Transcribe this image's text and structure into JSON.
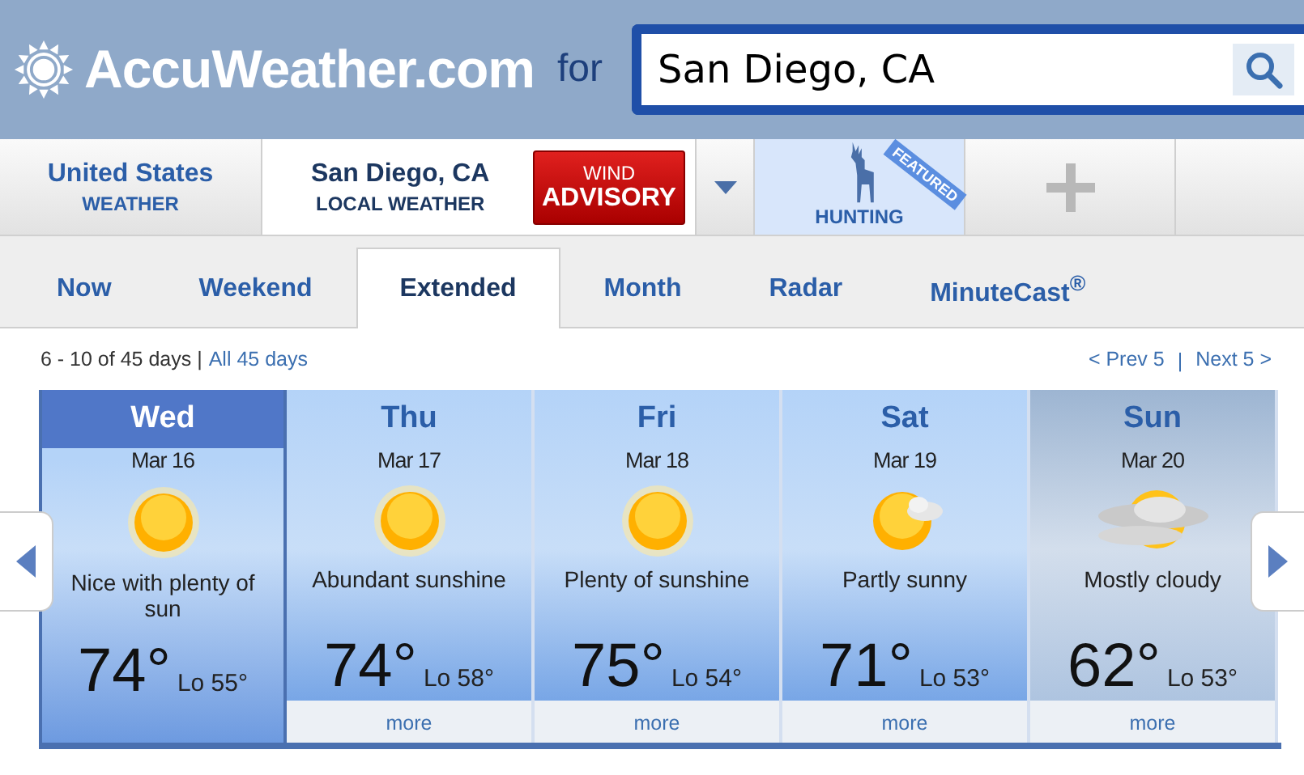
{
  "header": {
    "logo": "AccuWeather.com",
    "for_label": "for",
    "search": {
      "value": "San Diego, CA"
    }
  },
  "location_bar": [
    {
      "kind": "region",
      "title": "United States",
      "subtitle": "WEATHER",
      "selected": false
    },
    {
      "kind": "local",
      "title": "San Diego, CA",
      "subtitle": "LOCAL WEATHER",
      "selected": true,
      "alert": {
        "line1": "WIND",
        "line2": "ADVISORY"
      }
    },
    {
      "kind": "dropdown"
    },
    {
      "kind": "featured",
      "label": "HUNTING",
      "ribbon": "FEATURED"
    },
    {
      "kind": "add"
    }
  ],
  "tabs": [
    {
      "label": "Now",
      "selected": false
    },
    {
      "label": "Weekend",
      "selected": false
    },
    {
      "label": "Extended",
      "selected": true
    },
    {
      "label": "Month",
      "selected": false
    },
    {
      "label": "Radar",
      "selected": false
    },
    {
      "label": "MinuteCast$^{®}$",
      "selected": false
    }
  ],
  "range": {
    "text": "6 - 10 of 45 days |",
    "link": "All 45 days",
    "prev": "< Prev 5",
    "separator": "|",
    "next": "Next 5 >"
  },
  "days": [
    {
      "day": "Wed",
      "date": "Mar 16",
      "kind": "sunny",
      "condition": "Nice with plenty of sun",
      "high": "74°",
      "low": "Lo 55°",
      "selected": true
    },
    {
      "day": "Thu",
      "date": "Mar 17",
      "kind": "sunny",
      "condition": "Abundant sunshine",
      "high": "74°",
      "low": "Lo 58°",
      "more": "more",
      "selected": false
    },
    {
      "day": "Fri",
      "date": "Mar 18",
      "kind": "sunny",
      "condition": "Plenty of sunshine",
      "high": "75°",
      "low": "Lo 54°",
      "more": "more",
      "selected": false
    },
    {
      "day": "Sat",
      "date": "Mar 19",
      "kind": "partly",
      "condition": "Partly sunny",
      "high": "71°",
      "low": "Lo 53°",
      "more": "more",
      "selected": false
    },
    {
      "day": "Sun",
      "date": "Mar 20",
      "kind": "cloudy",
      "condition": "Mostly cloudy",
      "high": "62°",
      "low": "Lo 53°",
      "more": "more",
      "selected": false
    }
  ]
}
